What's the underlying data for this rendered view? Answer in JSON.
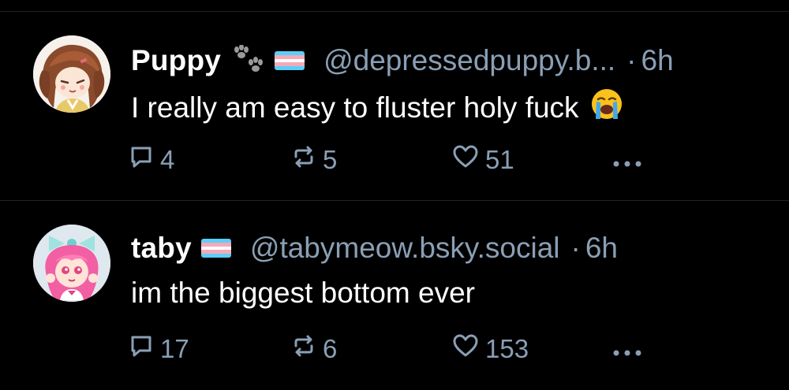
{
  "colors": {
    "background": "#000000",
    "divider": "#1c232c",
    "muted": "#8a9fb5",
    "text": "#ffffff"
  },
  "posts": [
    {
      "display_name": "Puppy",
      "badges": [
        "paw-prints-icon",
        "trans-flag-icon"
      ],
      "handle": "@depressedpuppy.b...",
      "separator": "·",
      "time": "6h",
      "text": "I really am easy to fluster holy fuck",
      "emoji": "loudly-crying-face-emoji",
      "replies": "4",
      "reposts": "5",
      "likes": "51"
    },
    {
      "display_name": "taby",
      "badges": [
        "trans-flag-icon"
      ],
      "handle": "@tabymeow.bsky.social",
      "separator": "·",
      "time": "6h",
      "text": "im the biggest bottom ever",
      "replies": "17",
      "reposts": "6",
      "likes": "153"
    }
  ]
}
